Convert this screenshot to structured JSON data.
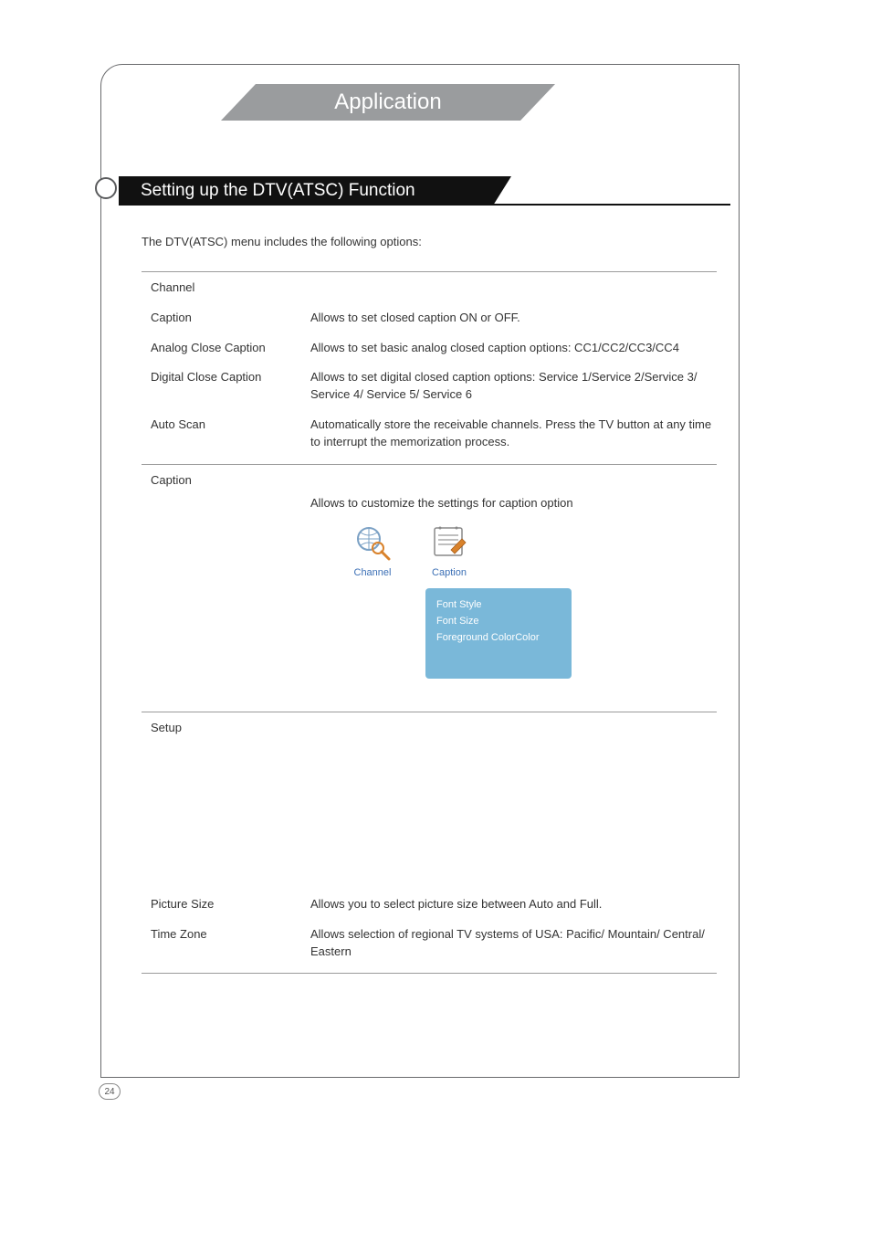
{
  "header": {
    "app_tab": "Application"
  },
  "section_title": "Setting up the DTV(ATSC) Function",
  "intro": "The DTV(ATSC) menu includes the following options:",
  "group1": {
    "header": "Channel",
    "rows": [
      {
        "label": "Caption",
        "desc": "Allows to set closed caption ON or OFF."
      },
      {
        "label": "Analog Close Caption",
        "desc": "Allows to set basic analog closed caption options: CC1/CC2/CC3/CC4"
      },
      {
        "label": "Digital Close Caption",
        "desc": "Allows to set digital closed caption options: Service 1/Service 2/Service 3/ Service 4/ Service 5/ Service 6"
      },
      {
        "label": "Auto Scan",
        "desc": "Automatically store the receivable channels. Press the TV button at any time to interrupt the memorization process."
      }
    ]
  },
  "group2": {
    "header": "Caption",
    "desc": "Allows to customize the settings for caption option",
    "icons": {
      "channel": "Channel",
      "caption": "Caption"
    },
    "menu": {
      "item1": "Font Style",
      "item2": "Font Size",
      "item3": "Foreground ColorColor"
    }
  },
  "group3": {
    "header": "Setup",
    "rows": [
      {
        "label": "Picture Size",
        "desc": "Allows you to select picture size between Auto and Full."
      },
      {
        "label": "Time Zone",
        "desc": "Allows selection of regional TV systems of USA: Pacific/ Mountain/ Central/ Eastern"
      }
    ]
  },
  "page_number": "24"
}
